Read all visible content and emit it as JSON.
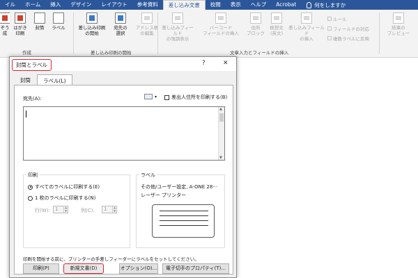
{
  "ribbon_tabs": [
    "イル",
    "ホーム",
    "挿入",
    "デザイン",
    "レイアウト",
    "参考資料",
    "差し込み文書",
    "校閲",
    "表示",
    "ヘルプ",
    "Acrobat"
  ],
  "tell_me": "何をしますか",
  "ribbon": {
    "create_group": {
      "label": "作成",
      "buttons": [
        "封筒",
        "ラベル"
      ],
      "cut_1a": "ぞう",
      "cut_1b": "成",
      "cut_2a": "はがき",
      "cut_2b": "印刷"
    },
    "start_group": {
      "label": "差し込み印刷の開始",
      "start_a": "差し込み印刷",
      "start_b": "の開始",
      "recipient_a": "宛先の",
      "recipient_b": "選択",
      "address_a": "アドレス帳",
      "address_b": "の編集"
    },
    "insert_group": {
      "label": "文章入力とフィールドの挿入",
      "highlight_a": "差し込みフィールド",
      "highlight_b": "の強調表示",
      "barcode_a": "バーコード",
      "barcode_b": "フィールドの挿入",
      "address_block_a": "住所",
      "address_block_b": "ブロック",
      "greeting_a": "挨拶文",
      "greeting_b": "(英文)",
      "insert_field_a": "差し込みフィールド",
      "insert_field_b": "の挿入",
      "rules": "ルール",
      "match_fields": "フィールドの対応",
      "update_labels": "複数ラベルに反映"
    },
    "preview_a": "結果の",
    "preview_b": "プレビュー"
  },
  "dialog": {
    "title": "封筒とラベル",
    "help_btn": "?",
    "close_btn": "✕",
    "tabs": [
      "封筒",
      "ラベル(L)"
    ],
    "address_label": "宛先(A):",
    "omit_return_label": "差出人住所を印刷する(B)",
    "print_section": {
      "legend": "印刷",
      "full_page_label": "すべてのラベルに印刷する(E)",
      "single_label": "1 枚のラベルに印刷する(N)",
      "row_label": "行(W):",
      "row_value": "1",
      "col_label": "列(C):",
      "col_value": "1"
    },
    "label_section": {
      "legend": "ラベル",
      "vendor_text": "その他/ユーザー設定, A-ONE 28···",
      "type_text": "レーザー プリンター"
    },
    "note": "印刷を開始する前に、プリンターの手差しフィーダーにラベルをセットしてください。",
    "buttons": {
      "print": "印刷(P)",
      "new_document": "新規文書(D)",
      "options": "オプション(O)...",
      "epostage": "電子切手のプロパティ(T)..."
    }
  },
  "colors": {
    "ribbon_blue": "#2b579a",
    "highlight_red": "#d9232e"
  }
}
